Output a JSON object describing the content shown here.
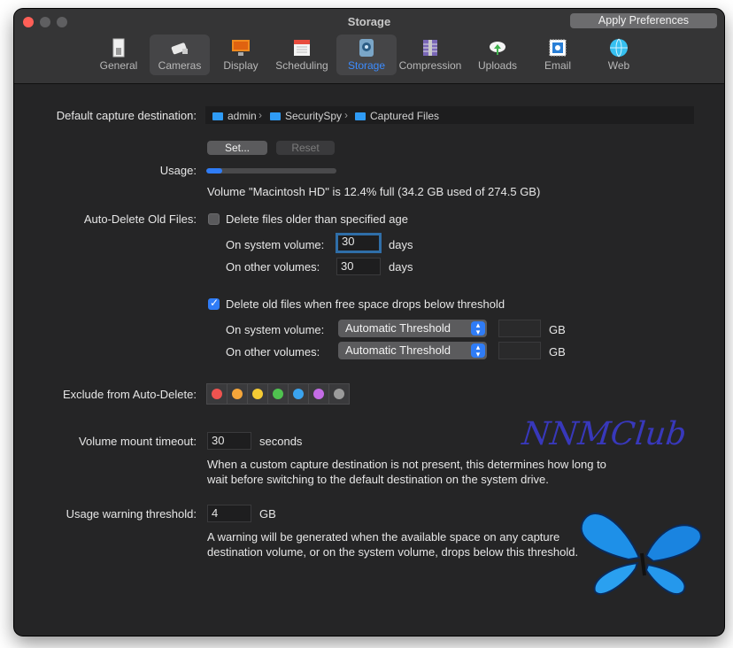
{
  "window": {
    "title": "Storage"
  },
  "toolbar": {
    "apply_label": "Apply Preferences",
    "tabs": [
      {
        "label": "General",
        "icon": "general-switch-icon",
        "selected": false,
        "active": false
      },
      {
        "label": "Cameras",
        "icon": "camera-icon",
        "selected": true,
        "active": false
      },
      {
        "label": "Display",
        "icon": "display-icon",
        "selected": false,
        "active": false
      },
      {
        "label": "Scheduling",
        "icon": "calendar-icon",
        "selected": false,
        "active": false
      },
      {
        "label": "Storage",
        "icon": "hard-drive-icon",
        "selected": true,
        "active": true
      },
      {
        "label": "Compression",
        "icon": "compress-icon",
        "selected": false,
        "active": false
      },
      {
        "label": "Uploads",
        "icon": "cloud-upload-icon",
        "selected": false,
        "active": false
      },
      {
        "label": "Email",
        "icon": "stamp-icon",
        "selected": false,
        "active": false
      },
      {
        "label": "Web",
        "icon": "globe-icon",
        "selected": false,
        "active": false
      }
    ]
  },
  "capture": {
    "label": "Default capture destination:",
    "path": [
      "admin",
      "SecuritySpy",
      "Captured Files"
    ],
    "set_label": "Set...",
    "reset_label": "Reset"
  },
  "usage": {
    "label": "Usage:",
    "fraction": 0.124,
    "summary": "Volume \"Macintosh HD\" is 12.4% full (34.2 GB used of 274.5 GB)"
  },
  "auto_delete": {
    "label": "Auto-Delete Old Files:",
    "age_checkbox_label": "Delete files older than specified age",
    "age_checked": false,
    "system_label": "On system volume:",
    "system_days": "30",
    "other_label": "On other volumes:",
    "other_days": "30",
    "days_unit": "days",
    "space_checkbox_label": "Delete old files when free space drops below threshold",
    "space_checked": true,
    "threshold_system_label": "On system volume:",
    "threshold_system_value": "Automatic Threshold",
    "threshold_other_label": "On other volumes:",
    "threshold_other_value": "Automatic Threshold",
    "gb_unit": "GB"
  },
  "exclude": {
    "label": "Exclude from Auto-Delete:",
    "colors": [
      "#ef5350",
      "#f5a63a",
      "#f5cb34",
      "#4fc24f",
      "#3aa3ee",
      "#c46ce6",
      "#9b9b9b"
    ]
  },
  "mount": {
    "label": "Volume mount timeout:",
    "value": "30",
    "unit": "seconds",
    "note_line1": "When a custom capture destination is not present, this determines how long to",
    "note_line2": "wait before switching to the default destination on the system drive."
  },
  "warning": {
    "label": "Usage warning threshold:",
    "value": "4",
    "unit": "GB",
    "note_line1": "A warning will be generated when the available space on any capture",
    "note_line2": "destination volume, or on the system volume, drops below this threshold."
  },
  "watermark": {
    "text": "NNMClub"
  }
}
